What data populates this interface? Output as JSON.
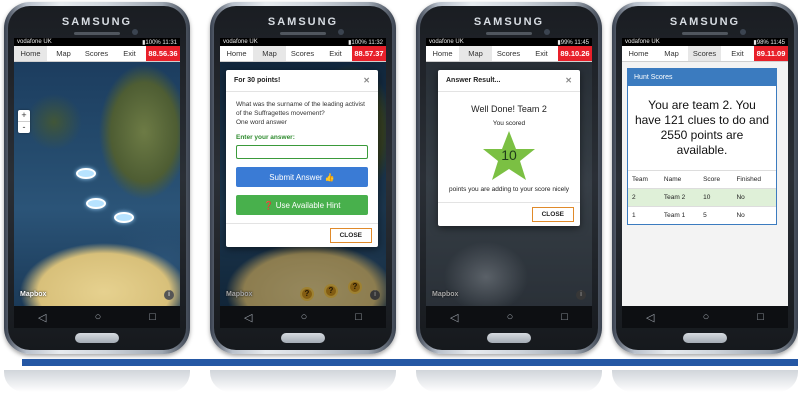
{
  "phone_brand": "SAMSUNG",
  "status": {
    "carrier": "vodafone UK"
  },
  "tabs": [
    "Home",
    "Map",
    "Scores",
    "Exit"
  ],
  "phones": [
    {
      "battery": "100%",
      "time": "11:31",
      "timer": "88.56.36",
      "active_tab": "Home"
    },
    {
      "battery": "100%",
      "time": "11:32",
      "timer": "88.57.37",
      "active_tab": "Map"
    },
    {
      "battery": "99%",
      "time": "11:45",
      "timer": "89.10.26",
      "active_tab": "Map"
    },
    {
      "battery": "98%",
      "time": "11:45",
      "timer": "89.11.09",
      "active_tab": "Scores"
    }
  ],
  "map": {
    "attribution": "Mapbox",
    "zoom_in": "+",
    "zoom_out": "-",
    "info": "i",
    "clue_marker": "?"
  },
  "question": {
    "title": "For 30 points!",
    "text": "What was the surname of the leading activist of the Suffragettes movement?",
    "hint_text": "One word answer",
    "answer_label": "Enter your answer:",
    "answer_value": "",
    "submit_label": "Submit Answer",
    "hint_button_label": "Use Available Hint",
    "close_label": "CLOSE"
  },
  "result": {
    "title": "Answer Result...",
    "heading": "Well Done! Team 2",
    "scored_label": "You scored",
    "points": "10",
    "message": "points you are adding to your score nicely",
    "close_label": "CLOSE"
  },
  "scores": {
    "panel_title": "Hunt Scores",
    "summary": "You are team 2. You have 121 clues to do and 2550 points are available.",
    "columns": [
      "Team",
      "Name",
      "Score",
      "Finished"
    ],
    "rows": [
      {
        "team": "2",
        "name": "Team 2",
        "score": "10",
        "finished": "No"
      },
      {
        "team": "1",
        "name": "Team 1",
        "score": "5",
        "finished": "No"
      }
    ]
  },
  "nav_icons": [
    "back-icon",
    "home-icon",
    "recents-icon"
  ],
  "colors": {
    "timer": "#e8202a",
    "submit": "#3a7bd5",
    "hint": "#48b04c",
    "star": "#7bc043",
    "panel": "#3b7bbf",
    "highlight_row": "#dff0d8",
    "bar": "#2457a4"
  }
}
